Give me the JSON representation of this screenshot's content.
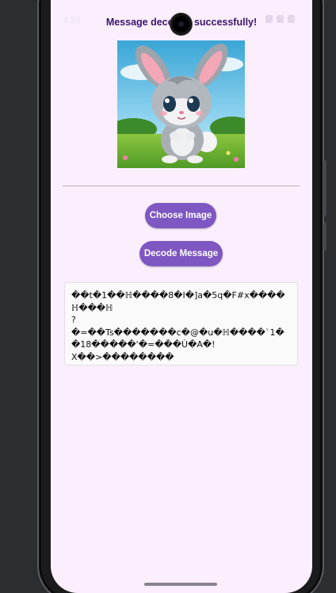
{
  "status_bar": {
    "time": "4:59"
  },
  "toast": {
    "text": "Message decoded successfully!"
  },
  "image": {
    "subject": "cartoon bunny"
  },
  "buttons": {
    "choose_image": "Choose Image",
    "decode_message": "Decode Message"
  },
  "decoded": {
    "text": "��t�1��ℍ����8�I�]a�5q�F#x����ℍ���ℍ\n?\n�=��Ts�������c�@�u�ℍ����`1��18�����'�=���Ù�A�!\nX��>��������"
  },
  "colors": {
    "accent": "#7e57c2",
    "background": "#fbeffd",
    "toast_text": "#3a146c"
  }
}
